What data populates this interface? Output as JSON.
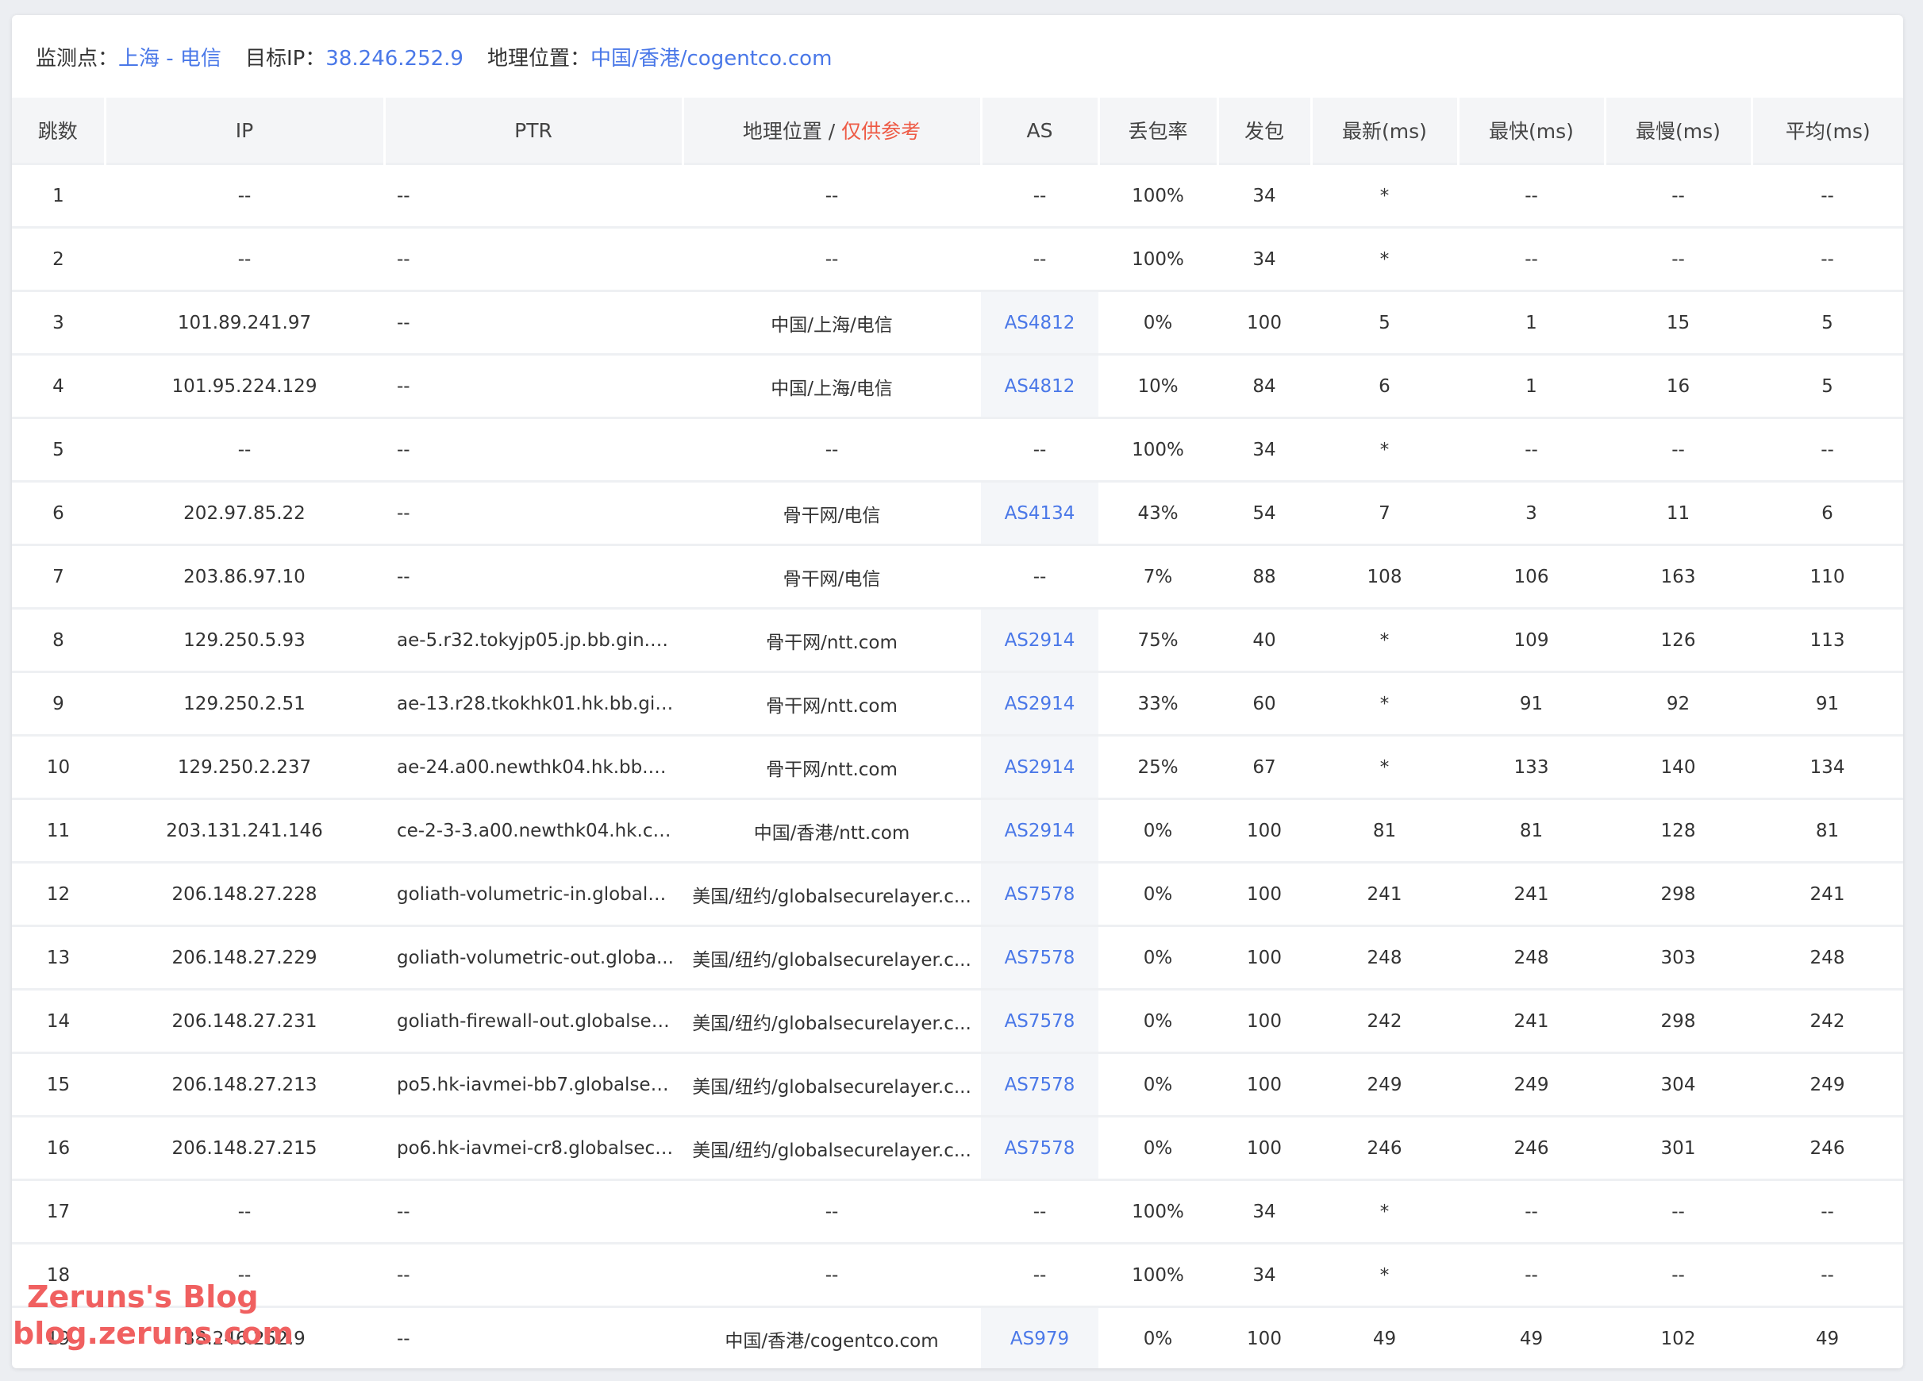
{
  "info": {
    "monitor_label": "监测点：",
    "monitor_value": "上海 - 电信",
    "target_label": "目标IP：",
    "target_value": "38.246.252.9",
    "geo_label": "地理位置：",
    "geo_value": "中国/香港/cogentco.com"
  },
  "headers": {
    "hop": "跳数",
    "ip": "IP",
    "ptr": "PTR",
    "geo": "地理位置 / ",
    "geo_note": "仅供参考",
    "as": "AS",
    "loss": "丢包率",
    "sent": "发包",
    "last": "最新(ms)",
    "best": "最快(ms)",
    "worst": "最慢(ms)",
    "avg": "平均(ms)"
  },
  "rows": [
    {
      "hop": "1",
      "ip": "--",
      "ptr": "--",
      "geo": "--",
      "as": "--",
      "loss": "100%",
      "sent": "34",
      "last": "*",
      "best": "--",
      "worst": "--",
      "avg": "--"
    },
    {
      "hop": "2",
      "ip": "--",
      "ptr": "--",
      "geo": "--",
      "as": "--",
      "loss": "100%",
      "sent": "34",
      "last": "*",
      "best": "--",
      "worst": "--",
      "avg": "--"
    },
    {
      "hop": "3",
      "ip": "101.89.241.97",
      "ptr": "--",
      "geo": "中国/上海/电信",
      "as": "AS4812",
      "loss": "0%",
      "sent": "100",
      "last": "5",
      "best": "1",
      "worst": "15",
      "avg": "5"
    },
    {
      "hop": "4",
      "ip": "101.95.224.129",
      "ptr": "--",
      "geo": "中国/上海/电信",
      "as": "AS4812",
      "loss": "10%",
      "sent": "84",
      "last": "6",
      "best": "1",
      "worst": "16",
      "avg": "5"
    },
    {
      "hop": "5",
      "ip": "--",
      "ptr": "--",
      "geo": "--",
      "as": "--",
      "loss": "100%",
      "sent": "34",
      "last": "*",
      "best": "--",
      "worst": "--",
      "avg": "--"
    },
    {
      "hop": "6",
      "ip": "202.97.85.22",
      "ptr": "--",
      "geo": "骨干网/电信",
      "as": "AS4134",
      "loss": "43%",
      "sent": "54",
      "last": "7",
      "best": "3",
      "worst": "11",
      "avg": "6"
    },
    {
      "hop": "7",
      "ip": "203.86.97.10",
      "ptr": "--",
      "geo": "骨干网/电信",
      "as": "--",
      "loss": "7%",
      "sent": "88",
      "last": "108",
      "best": "106",
      "worst": "163",
      "avg": "110"
    },
    {
      "hop": "8",
      "ip": "129.250.5.93",
      "ptr": "ae-5.r32.tokyjp05.jp.bb.gin.nt...",
      "geo": "骨干网/ntt.com",
      "as": "AS2914",
      "loss": "75%",
      "sent": "40",
      "last": "*",
      "best": "109",
      "worst": "126",
      "avg": "113"
    },
    {
      "hop": "9",
      "ip": "129.250.2.51",
      "ptr": "ae-13.r28.tkokhk01.hk.bb.gin...",
      "geo": "骨干网/ntt.com",
      "as": "AS2914",
      "loss": "33%",
      "sent": "60",
      "last": "*",
      "best": "91",
      "worst": "92",
      "avg": "91"
    },
    {
      "hop": "10",
      "ip": "129.250.2.237",
      "ptr": "ae-24.a00.newthk04.hk.bb.gi...",
      "geo": "骨干网/ntt.com",
      "as": "AS2914",
      "loss": "25%",
      "sent": "67",
      "last": "*",
      "best": "133",
      "worst": "140",
      "avg": "134"
    },
    {
      "hop": "11",
      "ip": "203.131.241.146",
      "ptr": "ce-2-3-3.a00.newthk04.hk.ce....",
      "geo": "中国/香港/ntt.com",
      "as": "AS2914",
      "loss": "0%",
      "sent": "100",
      "last": "81",
      "best": "81",
      "worst": "128",
      "avg": "81"
    },
    {
      "hop": "12",
      "ip": "206.148.27.228",
      "ptr": "goliath-volumetric-in.globals...",
      "geo": "美国/纽约/globalsecurelayer.c...",
      "as": "AS7578",
      "loss": "0%",
      "sent": "100",
      "last": "241",
      "best": "241",
      "worst": "298",
      "avg": "241"
    },
    {
      "hop": "13",
      "ip": "206.148.27.229",
      "ptr": "goliath-volumetric-out.globa...",
      "geo": "美国/纽约/globalsecurelayer.c...",
      "as": "AS7578",
      "loss": "0%",
      "sent": "100",
      "last": "248",
      "best": "248",
      "worst": "303",
      "avg": "248"
    },
    {
      "hop": "14",
      "ip": "206.148.27.231",
      "ptr": "goliath-firewall-out.globalsec...",
      "geo": "美国/纽约/globalsecurelayer.c...",
      "as": "AS7578",
      "loss": "0%",
      "sent": "100",
      "last": "242",
      "best": "241",
      "worst": "298",
      "avg": "242"
    },
    {
      "hop": "15",
      "ip": "206.148.27.213",
      "ptr": "po5.hk-iavmei-bb7.globalsec...",
      "geo": "美国/纽约/globalsecurelayer.c...",
      "as": "AS7578",
      "loss": "0%",
      "sent": "100",
      "last": "249",
      "best": "249",
      "worst": "304",
      "avg": "249"
    },
    {
      "hop": "16",
      "ip": "206.148.27.215",
      "ptr": "po6.hk-iavmei-cr8.globalsecu...",
      "geo": "美国/纽约/globalsecurelayer.c...",
      "as": "AS7578",
      "loss": "0%",
      "sent": "100",
      "last": "246",
      "best": "246",
      "worst": "301",
      "avg": "246"
    },
    {
      "hop": "17",
      "ip": "--",
      "ptr": "--",
      "geo": "--",
      "as": "--",
      "loss": "100%",
      "sent": "34",
      "last": "*",
      "best": "--",
      "worst": "--",
      "avg": "--"
    },
    {
      "hop": "18",
      "ip": "--",
      "ptr": "--",
      "geo": "--",
      "as": "--",
      "loss": "100%",
      "sent": "34",
      "last": "*",
      "best": "--",
      "worst": "--",
      "avg": "--"
    },
    {
      "hop": "19",
      "ip": "38.246.252.9",
      "ptr": "--",
      "geo": "中国/香港/cogentco.com",
      "as": "AS979",
      "loss": "0%",
      "sent": "100",
      "last": "49",
      "best": "49",
      "worst": "102",
      "avg": "49"
    }
  ],
  "watermark": {
    "line1": "Zeruns's Blog",
    "line2": "blog.zeruns.com"
  },
  "colors": {
    "link": "#4a78e8",
    "note": "#ee5a45",
    "watermark": "#f06060"
  }
}
